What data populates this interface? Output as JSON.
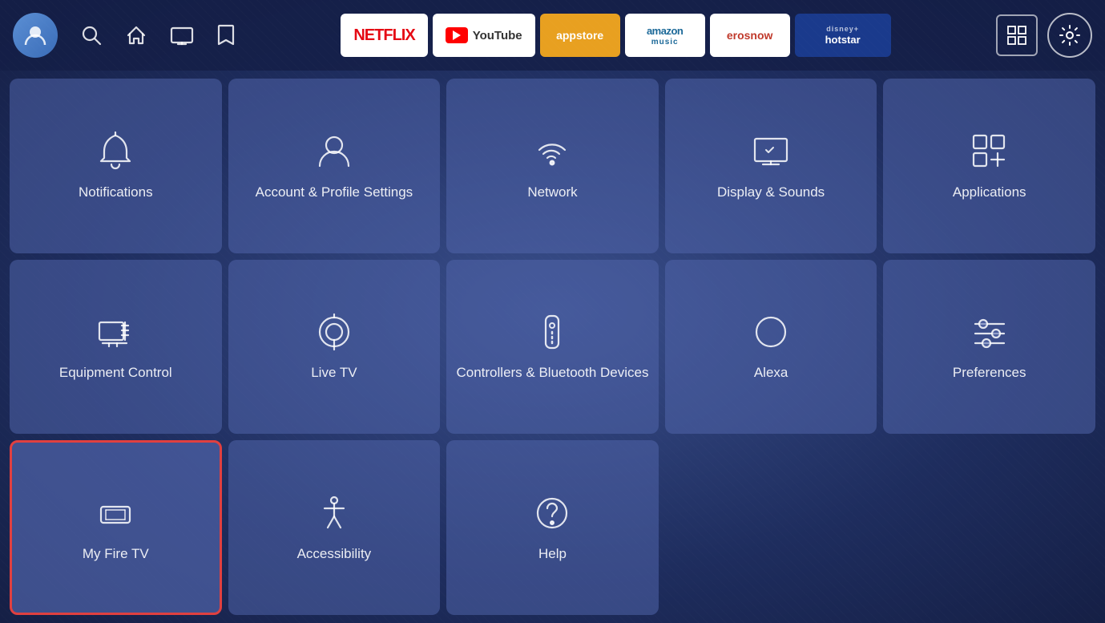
{
  "topbar": {
    "avatar_label": "👤",
    "nav_icons": {
      "search": "🔍",
      "home": "🏠",
      "tv": "📺",
      "bookmark": "🔖"
    },
    "apps": [
      {
        "id": "netflix",
        "label": "NETFLIX",
        "style": "netflix"
      },
      {
        "id": "youtube",
        "label": "YouTube",
        "style": "youtube"
      },
      {
        "id": "appstore",
        "label": "appstore",
        "style": "appstore"
      },
      {
        "id": "amazon-music",
        "label": "amazon music",
        "style": "amazon-music"
      },
      {
        "id": "erosnow",
        "label": "erosnow",
        "style": "eros"
      },
      {
        "id": "hotstar",
        "label": "disney+ hotstar",
        "style": "hotstar"
      }
    ],
    "settings_label": "⚙"
  },
  "tiles": [
    {
      "id": "notifications",
      "label": "Notifications",
      "icon": "bell",
      "selected": false,
      "row": 1,
      "col": 1
    },
    {
      "id": "account-profile",
      "label": "Account & Profile Settings",
      "icon": "person",
      "selected": false,
      "row": 1,
      "col": 2
    },
    {
      "id": "network",
      "label": "Network",
      "icon": "wifi",
      "selected": false,
      "row": 1,
      "col": 3
    },
    {
      "id": "display-sounds",
      "label": "Display & Sounds",
      "icon": "display",
      "selected": false,
      "row": 1,
      "col": 4
    },
    {
      "id": "applications",
      "label": "Applications",
      "icon": "grid-plus",
      "selected": false,
      "row": 1,
      "col": 5
    },
    {
      "id": "equipment-control",
      "label": "Equipment Control",
      "icon": "monitor",
      "selected": false,
      "row": 2,
      "col": 1
    },
    {
      "id": "live-tv",
      "label": "Live TV",
      "icon": "antenna",
      "selected": false,
      "row": 2,
      "col": 2
    },
    {
      "id": "controllers-bluetooth",
      "label": "Controllers & Bluetooth Devices",
      "icon": "remote",
      "selected": false,
      "row": 2,
      "col": 3
    },
    {
      "id": "alexa",
      "label": "Alexa",
      "icon": "alexa",
      "selected": false,
      "row": 2,
      "col": 4
    },
    {
      "id": "preferences",
      "label": "Preferences",
      "icon": "sliders",
      "selected": false,
      "row": 2,
      "col": 5
    },
    {
      "id": "my-fire-tv",
      "label": "My Fire TV",
      "icon": "firetv",
      "selected": true,
      "row": 3,
      "col": 1
    },
    {
      "id": "accessibility",
      "label": "Accessibility",
      "icon": "accessibility",
      "selected": false,
      "row": 3,
      "col": 2
    },
    {
      "id": "help",
      "label": "Help",
      "icon": "help",
      "selected": false,
      "row": 3,
      "col": 3
    }
  ]
}
